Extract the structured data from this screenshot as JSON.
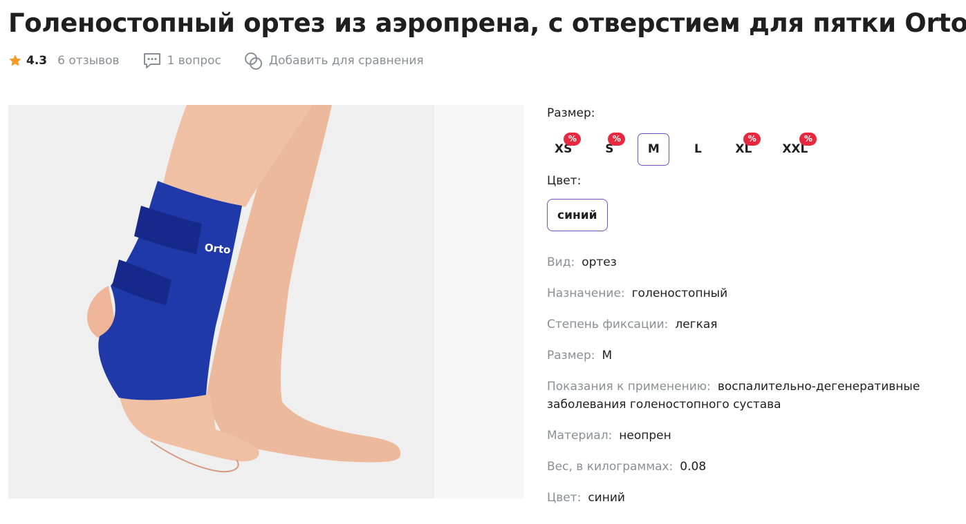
{
  "product": {
    "title": "Голеностопный ортез из аэропрена, с отверстием для пятки Orto NAS-",
    "rating": "4.3",
    "reviews": "6 отзывов",
    "questions": "1 вопрос",
    "compare": "Добавить для сравнения",
    "photo_brand": "Orto"
  },
  "sizes": {
    "label": "Размер:",
    "options": [
      {
        "label": "XS",
        "discount": "%"
      },
      {
        "label": "S",
        "discount": "%"
      },
      {
        "label": "M",
        "discount": ""
      },
      {
        "label": "L",
        "discount": ""
      },
      {
        "label": "XL",
        "discount": "%"
      },
      {
        "label": "XXL",
        "discount": "%"
      }
    ],
    "selected": "M"
  },
  "color": {
    "label": "Цвет:",
    "selected": "синий"
  },
  "specs": [
    {
      "key": "Вид:",
      "value": "ортез"
    },
    {
      "key": "Назначение:",
      "value": "голеностопный"
    },
    {
      "key": "Степень фиксации:",
      "value": "легкая"
    },
    {
      "key": "Размер:",
      "value": "M"
    },
    {
      "key": "Показания к применению:",
      "value": "воспалительно-дегенеративные заболевания голеностопного сустава"
    },
    {
      "key": "Материал:",
      "value": "неопрен"
    },
    {
      "key": "Вес, в килограммах:",
      "value": "0.08"
    },
    {
      "key": "Цвет:",
      "value": "синий"
    }
  ],
  "colors": {
    "accent": "#7a4ec4",
    "star": "#f79a24",
    "badge": "#e8283f",
    "muted": "#8b8e96",
    "orthosis": "#1f3aa8"
  },
  "icons": {
    "rating": "star-icon",
    "questions": "chat-bubble-icon",
    "compare": "compare-circles-icon"
  }
}
